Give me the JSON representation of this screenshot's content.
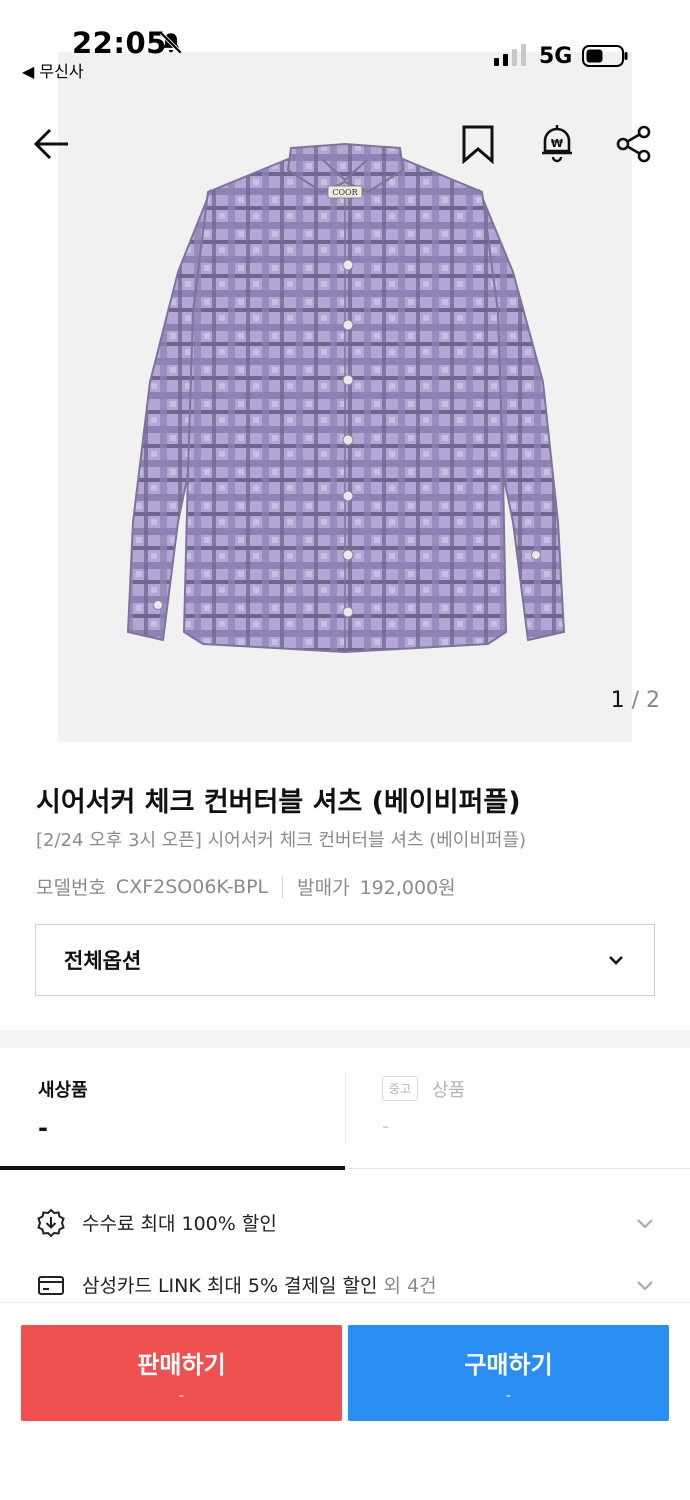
{
  "status_bar": {
    "time": "22:05",
    "back_app": "◀ 무신사",
    "network": "5G"
  },
  "top_bar": {
    "icons": [
      "back-arrow-icon",
      "bookmark-icon",
      "price-alert-icon",
      "share-icon"
    ]
  },
  "gallery": {
    "current": "1",
    "separator": "/",
    "total": "2",
    "brand_tag": "COOR"
  },
  "product": {
    "title": "시어서커 체크 컨버터블 셔츠 (베이비퍼플)",
    "subtitle": "[2/24 오후 3시 오픈] 시어서커 체크 컨버터블 셔츠 (베이비퍼플)",
    "model_label": "모델번호",
    "model_value": "CXF2SO06K-BPL",
    "release_label": "발매가",
    "release_value": "192,000원"
  },
  "option_select": {
    "label": "전체옵션"
  },
  "tabs": {
    "new": {
      "label": "새상품",
      "value": "-"
    },
    "used": {
      "badge": "중고",
      "label": "상품",
      "value": "-"
    }
  },
  "benefits": [
    {
      "text": "수수료 최대 100% 할인",
      "extra": ""
    },
    {
      "text": "삼성카드 LINK 최대 5% 결제일 할인",
      "extra": "외 4건"
    }
  ],
  "actions": {
    "sell": {
      "label": "판매하기",
      "sub": "-"
    },
    "buy": {
      "label": "구매하기",
      "sub": "-"
    }
  },
  "colors": {
    "sell": "#ef5050",
    "buy": "#2a8df2",
    "shirt": "#a99bc9"
  }
}
